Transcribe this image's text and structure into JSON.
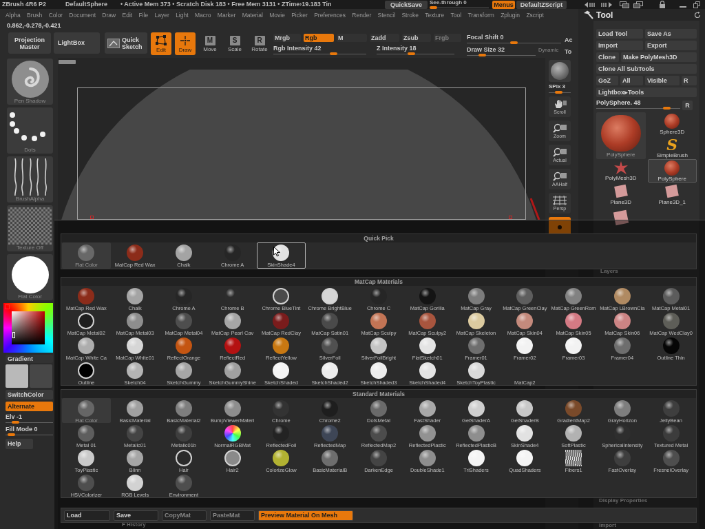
{
  "title_bar": {
    "app": "ZBrush 4R6 P2",
    "document": "DefaultSphere",
    "status": "• Active Mem 373 • Scratch Disk 183 • Free Mem 3131 • ZTime›19.183 Tin",
    "quick_save": "QuickSave",
    "see_through": {
      "label": "See-through 0",
      "level": 0
    },
    "menus": {
      "label": "Menus",
      "on": true
    },
    "script": "DefaultZScript"
  },
  "menu_bar": [
    "Alpha",
    "Brush",
    "Color",
    "Document",
    "Draw",
    "Edit",
    "File",
    "Layer",
    "Light",
    "Macro",
    "Marker",
    "Material",
    "Movie",
    "Picker",
    "Preferences",
    "Render",
    "Stencil",
    "Stroke",
    "Texture",
    "Tool",
    "Transform",
    "Zplugin",
    "Zscript"
  ],
  "coordinates": "0.862,-0.278,-0.421",
  "toolbar": {
    "projection_master": "Projection Master",
    "lightbox": "LightBox",
    "quick_sketch": "Quick Sketch",
    "modes": [
      {
        "label": "Edit",
        "kind": "edit",
        "on": true
      },
      {
        "label": "Draw",
        "kind": "draw",
        "on": true
      },
      {
        "label": "Move",
        "kind": "letter",
        "glyph": "M",
        "on": false
      },
      {
        "label": "Scale",
        "kind": "letter",
        "glyph": "S",
        "on": false
      },
      {
        "label": "Rotate",
        "kind": "letter",
        "glyph": "R",
        "on": false
      }
    ],
    "channels": [
      {
        "label": "Mrgb",
        "on": false
      },
      {
        "label": "Rgb",
        "on": true
      },
      {
        "label": "M",
        "on": false
      }
    ],
    "depth": [
      {
        "label": "Zadd",
        "disabled": false
      },
      {
        "label": "Zsub",
        "disabled": false
      },
      {
        "label": "Frgb",
        "disabled": true
      }
    ],
    "intensity_sliders": [
      {
        "label": "Rgb Intensity 42",
        "level": 0.66
      },
      {
        "label": "Z Intensity 18",
        "level": 0.44
      }
    ],
    "focal_shift": {
      "label": "Focal Shift 0",
      "level": 0.5
    },
    "draw_size": {
      "label": "Draw Size 32",
      "level": 0.19
    },
    "dynamic": {
      "label": "Dynamic",
      "on": false
    },
    "edge_labels": [
      "Ac",
      "To"
    ]
  },
  "left_shelf": {
    "thumbnails": [
      {
        "label": "Pen Shadow",
        "kind": "brush"
      },
      {
        "label": "Dots",
        "kind": "stroke"
      },
      {
        "label": "BrushAlpha",
        "kind": "alpha"
      },
      {
        "label": "Texture Off",
        "kind": "texture"
      },
      {
        "label": "Flat Color",
        "kind": "material"
      }
    ],
    "gradient": "Gradient",
    "swatches": [
      {
        "color": "#b9b9b9"
      },
      {
        "color": "#474747"
      }
    ],
    "switch_color": "SwitchColor",
    "alternate": {
      "label": "Alternate",
      "on": true
    },
    "sliders": [
      {
        "label": "Elv -1",
        "level": 0.15
      },
      {
        "label": "Fill Mode 0",
        "level": 0.05
      }
    ],
    "help": "Help"
  },
  "right_shelf": {
    "spix": {
      "label": "SPix 3",
      "level": 0.45
    },
    "buttons": [
      {
        "label": "Scroll",
        "kind": "hand",
        "on": false
      },
      {
        "label": "Zoom",
        "kind": "zoom",
        "on": false
      },
      {
        "label": "Actual",
        "kind": "zoom",
        "on": false
      },
      {
        "label": "AAHalf",
        "kind": "zoom",
        "on": false
      },
      {
        "label": "Persp",
        "kind": "grid",
        "on": false
      },
      {
        "kind": "dot",
        "on": true
      }
    ]
  },
  "tool_panel": {
    "title": "Tool",
    "button_rows": [
      [
        "Load Tool",
        "Save As"
      ],
      [
        "Import",
        "Export"
      ],
      [
        "Clone",
        "Make PolyMesh3D"
      ],
      [
        "Clone All SubTools"
      ],
      [
        "GoZ",
        "All",
        "Visible",
        "R"
      ],
      [
        "Lightbox▸Tools"
      ]
    ],
    "subtool": {
      "label": "PolySphere. 48",
      "level": 0.87,
      "reset": "R"
    },
    "current_tool": {
      "label": "PolySphere"
    },
    "thumbnails": [
      {
        "label": "Sphere3D",
        "kind": "sphere",
        "selected": false
      },
      {
        "label": "SimpleBrush",
        "kind": "letter",
        "glyph": "S",
        "selected": false
      },
      {
        "label": "PolyMesh3D",
        "kind": "star",
        "selected": false
      },
      {
        "label": "PolySphere",
        "kind": "sphere",
        "selected": true
      },
      {
        "label": "Plane3D",
        "kind": "plane",
        "selected": false
      },
      {
        "label": "Plane3D_1",
        "kind": "plane",
        "selected": false
      },
      {
        "kind": "plane",
        "selected": false
      }
    ]
  },
  "background_labels": [
    "Layers",
    "Display Properties",
    "F History",
    "Import"
  ],
  "material_picker": {
    "sections": [
      {
        "title": "Quick Pick",
        "items": [
          {
            "label": "Flat Color",
            "kind": "sphere",
            "color": "#686868",
            "selected": true,
            "hovered": false
          },
          {
            "label": "MatCap Red Wax",
            "kind": "sphere",
            "color": "#8c2c1a",
            "selected": false,
            "hovered": false
          },
          {
            "label": "Chalk",
            "kind": "sphere",
            "color": "#a4a4a4",
            "selected": false,
            "hovered": false
          },
          {
            "label": "Chrome A",
            "kind": "sphere",
            "color": "#262626",
            "selected": false,
            "hovered": false
          },
          {
            "label": "SkinShade4",
            "kind": "sphere",
            "color": "#e2e2e2",
            "selected": false,
            "hovered": true
          }
        ]
      },
      {
        "title": "MatCap Materials",
        "items": [
          {
            "label": "MatCap Red Wax",
            "kind": "sphere",
            "color": "#8c2c1a",
            "selected": false
          },
          {
            "label": "Chalk",
            "kind": "sphere",
            "color": "#a4a4a4",
            "selected": false
          },
          {
            "label": "Chrome A",
            "kind": "sphere",
            "color": "#262626",
            "selected": false
          },
          {
            "label": "Chrome B",
            "kind": "sphere",
            "color": "#2c2c2c",
            "selected": false
          },
          {
            "label": "Chrome BlueTint",
            "kind": "ring",
            "color": "#4a4a4a",
            "selected": false
          },
          {
            "label": "Chrome BrightBlue",
            "kind": "ring",
            "color": "#d6d6d6",
            "selected": false
          },
          {
            "label": "Chrome C",
            "kind": "sphere",
            "color": "#262626",
            "selected": false
          },
          {
            "label": "MatCap Gorilla",
            "kind": "sphere",
            "color": "#141414",
            "selected": false
          },
          {
            "label": "MatCap Gray",
            "kind": "sphere",
            "color": "#7c7c7c",
            "selected": false
          },
          {
            "label": "MatCap GreenClay",
            "kind": "sphere",
            "color": "#5e5e5e",
            "selected": false
          },
          {
            "label": "MatCap GreenRom",
            "kind": "sphere",
            "color": "#828282",
            "selected": false
          },
          {
            "label": "MatCap LBrownCla",
            "kind": "sphere",
            "color": "#b08a62",
            "selected": false
          },
          {
            "label": "MatCap Metal01",
            "kind": "sphere",
            "color": "#5c5c5c",
            "selected": false
          },
          {
            "label": "MatCap Metal02",
            "kind": "ring",
            "color": "#1e1e1e",
            "selected": false
          },
          {
            "label": "MatCap Metal03",
            "kind": "sphere",
            "color": "#8e8e8e",
            "selected": false
          },
          {
            "label": "MatCap Metal04",
            "kind": "sphere",
            "color": "#4e4e4e",
            "selected": false
          },
          {
            "label": "MatCap Pearl Cav",
            "kind": "sphere",
            "color": "#a6a6a6",
            "selected": false
          },
          {
            "label": "MatCap RedClay",
            "kind": "sphere",
            "color": "#7a1c1c",
            "selected": false
          },
          {
            "label": "MatCap Satin01",
            "kind": "sphere",
            "color": "#4a4a4a",
            "selected": false
          },
          {
            "label": "MatCap Sculpy",
            "kind": "sphere",
            "color": "#c27455",
            "selected": false
          },
          {
            "label": "MatCap Sculpy2",
            "kind": "sphere",
            "color": "#a8553e",
            "selected": false
          },
          {
            "label": "MatCap Skeleton",
            "kind": "sphere",
            "color": "#dccba0",
            "selected": false
          },
          {
            "label": "MatCap Skin04",
            "kind": "sphere",
            "color": "#c48a7c",
            "selected": false
          },
          {
            "label": "MatCap Skin05",
            "kind": "sphere",
            "color": "#d47a84",
            "selected": false
          },
          {
            "label": "MatCap Skin06",
            "kind": "sphere",
            "color": "#cc8484",
            "selected": false
          },
          {
            "label": "MatCap WedClay0",
            "kind": "sphere",
            "color": "#5e5e58",
            "selected": false
          },
          {
            "label": "MatCap White Ca",
            "kind": "sphere",
            "color": "#adadad",
            "selected": false
          },
          {
            "label": "MatCap White01",
            "kind": "sphere",
            "color": "#d6d6d6",
            "selected": false
          },
          {
            "label": "ReflectOrange",
            "kind": "sphere",
            "color": "#c45512",
            "selected": false
          },
          {
            "label": "ReflectRed",
            "kind": "sphere",
            "color": "#b41212",
            "selected": false
          },
          {
            "label": "ReflectYellow",
            "kind": "sphere",
            "color": "#c87812",
            "selected": false
          },
          {
            "label": "SilverFoil",
            "kind": "sphere",
            "color": "#505050",
            "selected": false
          },
          {
            "label": "SilverFoilBright",
            "kind": "sphere",
            "color": "#c4c4c4",
            "selected": false
          },
          {
            "label": "FlatSketch01",
            "kind": "sphere",
            "color": "#e4e4e4",
            "selected": false
          },
          {
            "label": "Framer01",
            "kind": "sphere",
            "color": "#6e6e6e",
            "selected": false
          },
          {
            "label": "Framer02",
            "kind": "sphere",
            "color": "#f2f2f2",
            "selected": false
          },
          {
            "label": "Framer03",
            "kind": "sphere",
            "color": "#f2f2f2",
            "selected": false
          },
          {
            "label": "Framer04",
            "kind": "sphere",
            "color": "#6e6e6e",
            "selected": false
          },
          {
            "label": "Outline Thin",
            "kind": "sphere",
            "color": "#060606",
            "selected": false
          },
          {
            "label": "Outline",
            "kind": "ring",
            "color": "#000000",
            "selected": false
          },
          {
            "label": "Sketch04",
            "kind": "sphere",
            "color": "#b4b4b4",
            "selected": false
          },
          {
            "label": "SketchGummy",
            "kind": "sphere",
            "color": "#a6a6a6",
            "selected": false
          },
          {
            "label": "SketchGummyShine",
            "kind": "sphere",
            "color": "#a0a0a0",
            "selected": false
          },
          {
            "label": "SketchShaded",
            "kind": "sphere",
            "color": "#f4f4f4",
            "selected": false
          },
          {
            "label": "SketchShaded2",
            "kind": "sphere",
            "color": "#ececec",
            "selected": false
          },
          {
            "label": "SketchShaded3",
            "kind": "sphere",
            "color": "#ececec",
            "selected": false
          },
          {
            "label": "SketchShaded4",
            "kind": "sphere",
            "color": "#e4e4e4",
            "selected": false
          },
          {
            "label": "SketchToyPlastic",
            "kind": "sphere",
            "color": "#dadada",
            "selected": false
          },
          {
            "label": "MatCap2",
            "kind": "blank",
            "selected": false
          }
        ]
      },
      {
        "title": "Standard Materials",
        "items": [
          {
            "label": "Flat Color",
            "kind": "sphere",
            "color": "#666666",
            "selected": true
          },
          {
            "label": "BasicMaterial",
            "kind": "sphere",
            "color": "#a0a0a0",
            "selected": false
          },
          {
            "label": "BasicMaterial2",
            "kind": "sphere",
            "color": "#7e7e7e",
            "selected": false
          },
          {
            "label": "BumpViewerMateri",
            "kind": "sphere",
            "color": "#8e8e8e",
            "selected": false
          },
          {
            "label": "Chrome",
            "kind": "sphere",
            "color": "#333333",
            "selected": false
          },
          {
            "label": "Chrome2",
            "kind": "sphere",
            "color": "#1e1e1e",
            "selected": false
          },
          {
            "label": "DotsMetal",
            "kind": "sphere",
            "color": "#6a6a6a",
            "selected": false
          },
          {
            "label": "FastShader",
            "kind": "sphere",
            "color": "#a8a8a8",
            "selected": false
          },
          {
            "label": "GelShaderA",
            "kind": "sphere",
            "color": "#cfcfcf",
            "selected": false
          },
          {
            "label": "GelShaderB",
            "kind": "sphere",
            "color": "#c8c8c8",
            "selected": false
          },
          {
            "label": "GradientMap2",
            "kind": "sphere",
            "color": "#7a4a2a",
            "selected": false
          },
          {
            "label": "GrayHorizon",
            "kind": "sphere",
            "color": "#7e7e7e",
            "selected": false
          },
          {
            "label": "JellyBean",
            "kind": "sphere",
            "color": "#3e3e3e",
            "selected": false
          },
          {
            "label": "Metal 01",
            "kind": "sphere",
            "color": "#5e5e5e",
            "selected": false
          },
          {
            "label": "Metalic01",
            "kind": "sphere",
            "color": "#444444",
            "selected": false
          },
          {
            "label": "Metalic01b",
            "kind": "sphere",
            "color": "#3e3e3e",
            "selected": false
          },
          {
            "label": "NormalRGBMat",
            "kind": "rainbow",
            "selected": false
          },
          {
            "label": "ReflectedFoil",
            "kind": "sphere",
            "color": "#232323",
            "selected": false
          },
          {
            "label": "ReflectedMap",
            "kind": "sphere",
            "color": "#3e4656",
            "selected": false
          },
          {
            "label": "ReflectedMap2",
            "kind": "sphere",
            "color": "#4c4c4c",
            "selected": false
          },
          {
            "label": "ReflectedPlastic",
            "kind": "sphere",
            "color": "#929292",
            "selected": false
          },
          {
            "label": "ReflectedPlasticB",
            "kind": "sphere",
            "color": "#8e8e8e",
            "selected": false
          },
          {
            "label": "SkinShade4",
            "kind": "sphere",
            "color": "#e2e2e2",
            "selected": false
          },
          {
            "label": "SoftPlastic",
            "kind": "sphere",
            "color": "#b2b2b2",
            "selected": false
          },
          {
            "label": "SphericalIntensity",
            "kind": "sphere",
            "color": "#2e2e2e",
            "selected": false
          },
          {
            "label": "Textured Metal",
            "kind": "sphere",
            "color": "#3c3c3c",
            "selected": false
          },
          {
            "label": "ToyPlastic",
            "kind": "sphere",
            "color": "#cacaca",
            "selected": false
          },
          {
            "label": "Blinn",
            "kind": "sphere",
            "color": "#a6a6a6",
            "selected": false
          },
          {
            "label": "Hair",
            "kind": "ring",
            "color": "#2a2a2a",
            "selected": false
          },
          {
            "label": "Hair2",
            "kind": "ring",
            "color": "#8a8a8a",
            "selected": false
          },
          {
            "label": "ColorizeGlow",
            "kind": "sphere",
            "color": "#b2b232",
            "selected": false
          },
          {
            "label": "BasicMaterialB",
            "kind": "sphere",
            "color": "#6e6e6e",
            "selected": false
          },
          {
            "label": "DarkenEdge",
            "kind": "sphere",
            "color": "#444444",
            "selected": false
          },
          {
            "label": "DoubleShade1",
            "kind": "sphere",
            "color": "#8e8e8e",
            "selected": false
          },
          {
            "label": "TriShaders",
            "kind": "sphere",
            "color": "#f4f4f4",
            "selected": false
          },
          {
            "label": "QuadShaders",
            "kind": "sphere",
            "color": "#f4f4f4",
            "selected": false
          },
          {
            "label": "Fibers1",
            "kind": "fibers",
            "selected": false
          },
          {
            "label": "FastOverlay",
            "kind": "sphere",
            "color": "#3e3e3e",
            "selected": false
          },
          {
            "label": "FresnelOverlay",
            "kind": "sphere",
            "color": "#4e4e4e",
            "selected": false
          },
          {
            "label": "HSVColorizer",
            "kind": "sphere",
            "color": "#4e4e4e",
            "selected": false
          },
          {
            "label": "RGB Levels",
            "kind": "sphere",
            "color": "#d2d2d2",
            "selected": false
          },
          {
            "label": "Environment",
            "kind": "sphere",
            "color": "#4e4e4e",
            "selected": false
          }
        ]
      }
    ],
    "buttons": [
      {
        "label": "Load",
        "disabled": false,
        "on": false
      },
      {
        "label": "Save",
        "disabled": false,
        "on": false
      },
      {
        "label": "CopyMat",
        "disabled": true,
        "on": false
      },
      {
        "label": "PasteMat",
        "disabled": true,
        "on": false
      },
      {
        "label": "Preview Material On Mesh",
        "disabled": false,
        "on": true
      }
    ]
  }
}
